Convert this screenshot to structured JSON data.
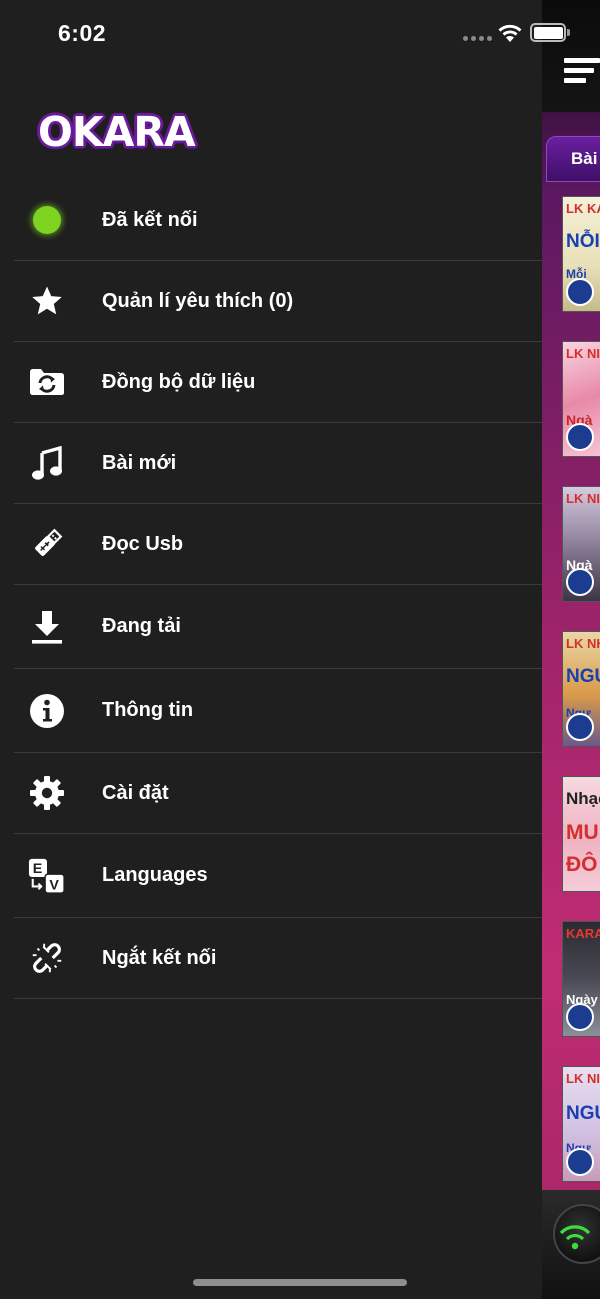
{
  "status_bar": {
    "time": "6:02"
  },
  "app": {
    "logo_text": "OKARA"
  },
  "menu": [
    {
      "label": "Đã kết nối",
      "icon": "connected-dot-icon"
    },
    {
      "label": "Quản lí yêu thích (0)",
      "icon": "star-icon"
    },
    {
      "label": "Đồng bộ dữ liệu",
      "icon": "sync-folder-icon"
    },
    {
      "label": "Bài mới",
      "icon": "music-note-icon"
    },
    {
      "label": "Đọc Usb",
      "icon": "usb-icon"
    },
    {
      "label": "Đang tải",
      "icon": "download-icon"
    },
    {
      "label": "Thông tin",
      "icon": "info-icon"
    },
    {
      "label": "Cài đặt",
      "icon": "gear-icon"
    },
    {
      "label": "Languages",
      "icon": "languages-icon"
    },
    {
      "label": "Ngắt kết nối",
      "icon": "disconnect-icon"
    }
  ],
  "colors": {
    "connected": "#7ed321",
    "drawer_bg": "#1f1f1f",
    "divider": "#3a3a3a",
    "accent_purple": "#6a1b9a",
    "panel_pink": "#c02c74",
    "wifi_green": "#3ddc3d"
  },
  "right_panel": {
    "tab_label": "Bài",
    "thumbnails": [
      {
        "line1": "LK KA",
        "big": "NỖI",
        "line2": "Mỗi"
      },
      {
        "line1": "LK NI",
        "big": "",
        "line2": "Ngà"
      },
      {
        "line1": "LK NI",
        "big": "",
        "line2": "Ngà"
      },
      {
        "line1": "LK NH",
        "big": "NGU",
        "line2": "Ngư"
      },
      {
        "line1": "Nhạc",
        "big": "MU",
        "line2": "ĐÔ"
      },
      {
        "line1": "KARA",
        "big": "",
        "line2": "Ngày"
      },
      {
        "line1": "LK NI",
        "big": "NGU",
        "line2": "Ngư"
      }
    ]
  }
}
